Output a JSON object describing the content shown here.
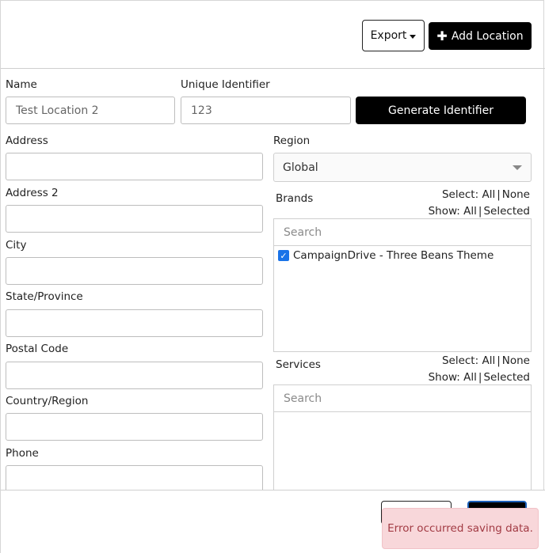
{
  "toolbar": {
    "export_label": "Export",
    "add_location_label": "Add Location"
  },
  "form": {
    "name": {
      "label": "Name",
      "value": "Test Location 2"
    },
    "unique_identifier": {
      "label": "Unique Identifier",
      "value": "123"
    },
    "generate_label": "Generate Identifier",
    "address": {
      "label": "Address",
      "value": ""
    },
    "address2": {
      "label": "Address 2",
      "value": ""
    },
    "city": {
      "label": "City",
      "value": ""
    },
    "state": {
      "label": "State/Province",
      "value": ""
    },
    "postal": {
      "label": "Postal Code",
      "value": ""
    },
    "country": {
      "label": "Country/Region",
      "value": ""
    },
    "phone": {
      "label": "Phone",
      "value": ""
    },
    "region": {
      "label": "Region",
      "value": "Global"
    }
  },
  "brands": {
    "label": "Brands",
    "select_prefix": "Select:",
    "show_prefix": "Show:",
    "all_label": "All",
    "none_label": "None",
    "selected_label": "Selected",
    "search_placeholder": "Search",
    "items": [
      {
        "label": "CampaignDrive - Three Beans Theme",
        "checked": true
      }
    ]
  },
  "services": {
    "label": "Services",
    "select_prefix": "Select:",
    "show_prefix": "Show:",
    "all_label": "All",
    "none_label": "None",
    "selected_label": "Selected",
    "search_placeholder": "Search"
  },
  "toast": {
    "message": "Error occurred saving data."
  },
  "colors": {
    "primary_button": "#000000",
    "checkbox": "#1a73e8",
    "toast_bg": "#f8d7da",
    "toast_text": "#a23b44"
  }
}
